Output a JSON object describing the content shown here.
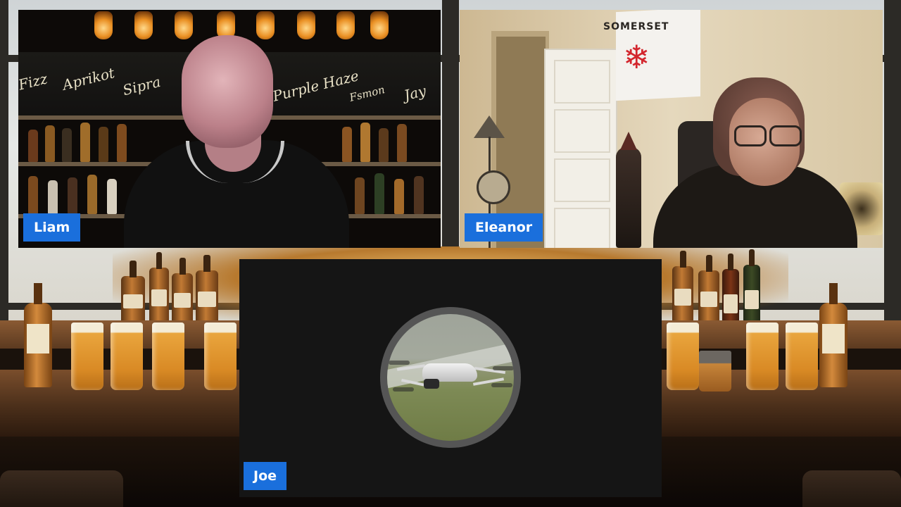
{
  "participants": [
    {
      "name": "Liam"
    },
    {
      "name": "Eleanor"
    },
    {
      "name": "Joe"
    }
  ],
  "eleanor_scene": {
    "flag_text": "SOMERSET"
  },
  "liam_scene": {
    "chalkboard": [
      "Aprikot",
      "Sipra",
      "Purple Haze",
      "Fsmon",
      "Jay",
      "Fizz"
    ]
  },
  "joe_tile": {
    "avatar": "drone-photo",
    "background": "#151515"
  },
  "colors": {
    "name_tag": "#1a6fdc",
    "name_text": "#ffffff"
  }
}
